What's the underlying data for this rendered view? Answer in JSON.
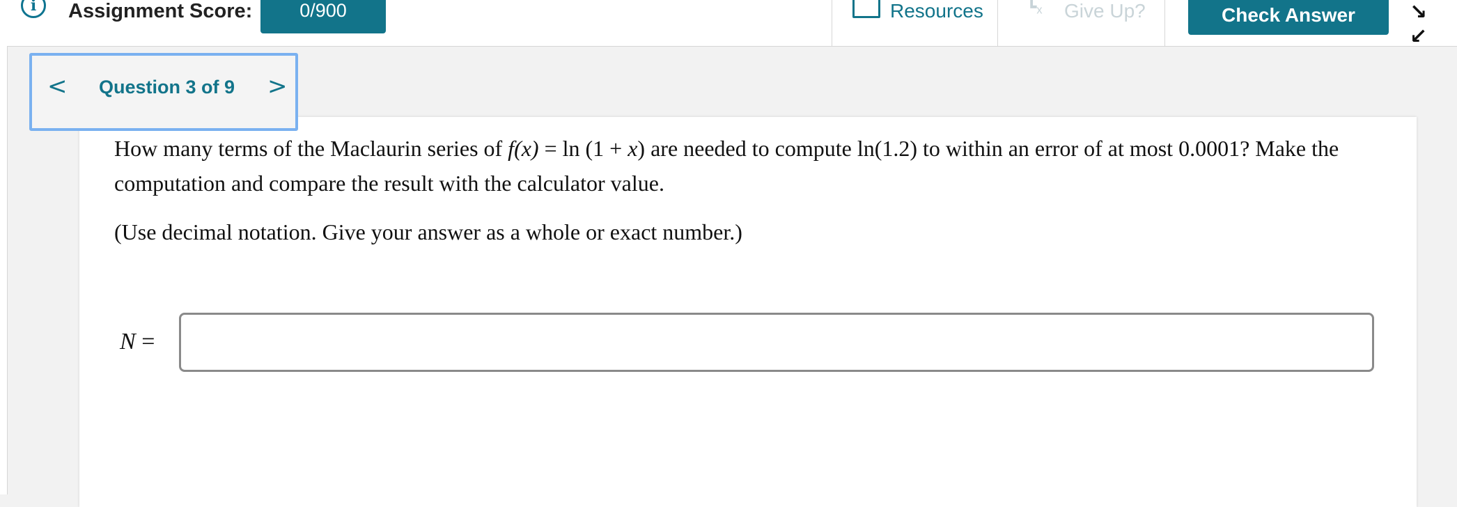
{
  "header": {
    "score_label": "Assignment Score:",
    "score_value": "0/900",
    "resources_label": "Resources",
    "giveup_label": "Give Up?",
    "check_answer_label": "Check Answer"
  },
  "icons": {
    "info": "info-circle-icon",
    "resources": "resources-box-icon",
    "giveup": "give-up-icon",
    "collapse": "collapse-arrows-icon",
    "prev": "chevron-left-icon",
    "next": "chevron-right-icon"
  },
  "colors": {
    "accent": "#12748a",
    "focus_ring": "#7ab1f0",
    "disabled_text": "#c9d4d8"
  },
  "question_nav": {
    "prev_glyph": "<",
    "title": "Question 3 of 9",
    "next_glyph": ">"
  },
  "question": {
    "part1": "How many terms of the Maclaurin series of ",
    "fx": "f(x)",
    "eq": " = ln (1 + ",
    "x": "x",
    "part2": ") are needed to compute ln(1.2) to within an error of at most 0.0001? Make the computation and compare the result with the calculator value.",
    "hint": "(Use decimal notation. Give your answer as a whole or exact number.)"
  },
  "answer": {
    "variable": "N",
    "equals": " =",
    "value": ""
  }
}
